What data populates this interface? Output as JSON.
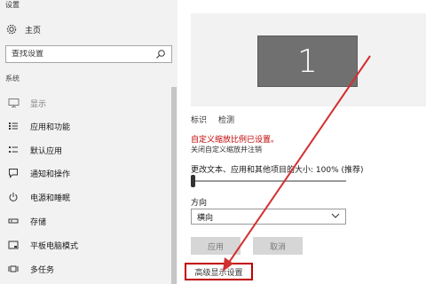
{
  "nav": {
    "title": "设置",
    "home_label": "主页",
    "search_placeholder": "查找设置",
    "group_label": "系统",
    "items": [
      {
        "label": "显示",
        "icon": "monitor-icon",
        "active": true
      },
      {
        "label": "应用和功能",
        "icon": "apps-list-icon"
      },
      {
        "label": "默认应用",
        "icon": "default-apps-icon"
      },
      {
        "label": "通知和操作",
        "icon": "notification-icon"
      },
      {
        "label": "电源和睡眠",
        "icon": "power-icon"
      },
      {
        "label": "存储",
        "icon": "storage-icon"
      },
      {
        "label": "平板电脑模式",
        "icon": "tablet-mode-icon"
      },
      {
        "label": "多任务",
        "icon": "multitask-icon"
      }
    ]
  },
  "display": {
    "monitor_number": "1",
    "identify_link": "标识",
    "detect_link": "检测",
    "warning": "自定义缩放比例已设置。",
    "warning_action": "关闭自定义缩放并注销",
    "scale_label": "更改文本、应用和其他项目的大小: 100% (推荐)",
    "scale_value_percent": 100,
    "orientation_label": "方向",
    "orientation_value": "横向",
    "apply_button": "应用",
    "cancel_button": "取消",
    "advanced_link": "高级显示设置"
  },
  "colors": {
    "accent_red": "#c00000",
    "nav_background": "#f2f2f2",
    "monitor_tile": "#707070"
  }
}
